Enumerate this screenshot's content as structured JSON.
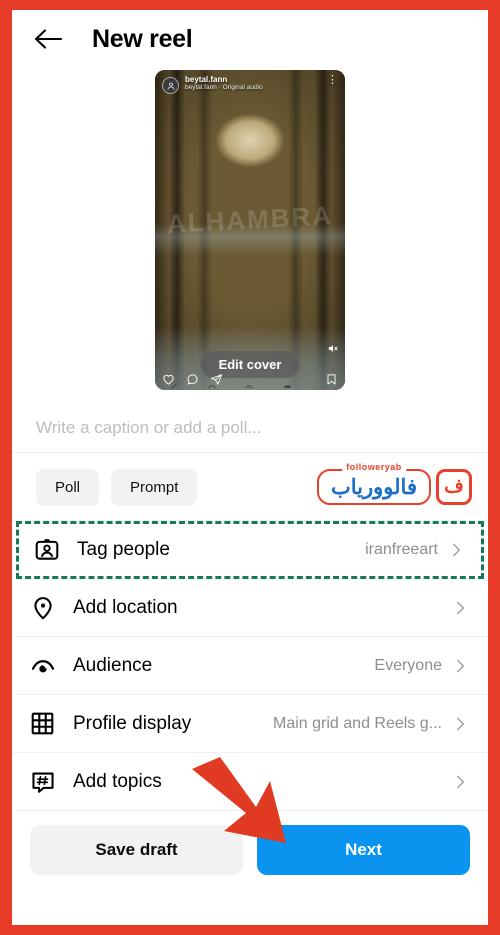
{
  "frame": {
    "border_color": "#E63B26"
  },
  "header": {
    "back_icon": "arrow-left-icon",
    "title": "New reel"
  },
  "preview": {
    "username": "beytal.fann",
    "audio": "beytal.fann · Original audio",
    "more_icon": "more-options-icon",
    "watermark": "ALHAMBRA",
    "edit_cover_label": "Edit cover",
    "mute_icon": "muted-speaker-icon",
    "actions": [
      "heart-icon",
      "comment-icon",
      "share-icon",
      "bookmark-icon"
    ]
  },
  "caption": {
    "value": "",
    "placeholder": "Write a caption or add a poll..."
  },
  "chips": {
    "poll_label": "Poll",
    "prompt_label": "Prompt"
  },
  "brand_watermark": {
    "latin": "followeryab",
    "persian": "فالووریاب",
    "mark": "ف",
    "red": "#E8412B",
    "blue": "#1B6FC4"
  },
  "settings": {
    "rows": [
      {
        "icon": "tag-people-icon",
        "label": "Tag people",
        "value": "iranfreeart",
        "chevron": "chevron-right-icon",
        "highlighted": true
      },
      {
        "icon": "location-pin-icon",
        "label": "Add location",
        "value": "",
        "chevron": "chevron-right-icon",
        "highlighted": false
      },
      {
        "icon": "audience-eye-icon",
        "label": "Audience",
        "value": "Everyone",
        "chevron": "chevron-right-icon",
        "highlighted": false
      },
      {
        "icon": "grid-icon",
        "label": "Profile display",
        "value": "Main grid and Reels g...",
        "chevron": "chevron-right-icon",
        "highlighted": false
      },
      {
        "icon": "hashtag-icon",
        "label": "Add topics",
        "value": "",
        "chevron": "chevron-right-icon",
        "highlighted": false
      }
    ],
    "highlight_color": "#16795A"
  },
  "footer": {
    "save_draft_label": "Save draft",
    "next_label": "Next",
    "next_color": "#0A94F0"
  },
  "annotation": {
    "arrow_icon": "red-down-right-arrow-annotation",
    "color": "#E03B22"
  }
}
